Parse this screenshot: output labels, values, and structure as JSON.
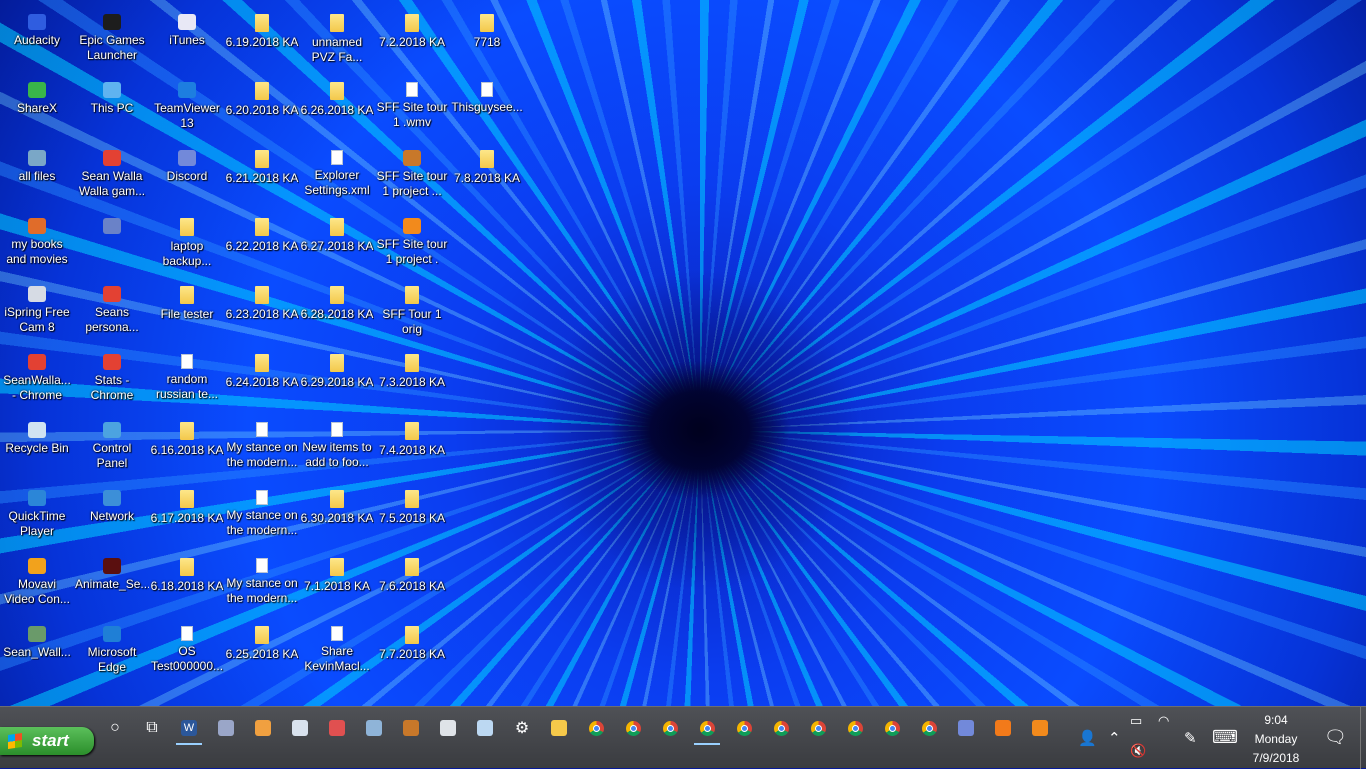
{
  "desktop": {
    "icons": [
      {
        "label1": "Audacity",
        "label2": "",
        "icon": "audacity-icon",
        "kind": "app",
        "color": "#2f5de0"
      },
      {
        "label1": "ShareX",
        "label2": "",
        "icon": "sharex-icon",
        "kind": "app",
        "color": "#39b54a"
      },
      {
        "label1": "all files",
        "label2": "",
        "icon": "monitor-icon",
        "kind": "app",
        "color": "#7aa7c7"
      },
      {
        "label1": "my books",
        "label2": "and movies",
        "icon": "books-icon",
        "kind": "app",
        "color": "#e06c2a"
      },
      {
        "label1": "iSpring Free",
        "label2": "Cam 8",
        "icon": "ispring-icon",
        "kind": "app",
        "color": "#d6dbe4"
      },
      {
        "label1": "SeanWalla...",
        "label2": "- Chrome",
        "icon": "chrome-app-icon",
        "kind": "app",
        "color": "#e34133"
      },
      {
        "label1": "Recycle Bin",
        "label2": "",
        "icon": "recycle-bin-icon",
        "kind": "app",
        "color": "#cfe3f2"
      },
      {
        "label1": "QuickTime",
        "label2": "Player",
        "icon": "quicktime-icon",
        "kind": "app",
        "color": "#2b86d8"
      },
      {
        "label1": "Movavi",
        "label2": "Video Con...",
        "icon": "movavi-icon",
        "kind": "app",
        "color": "#f2a21c"
      },
      {
        "label1": "Sean_Wall...",
        "label2": "",
        "icon": "user-figure-icon",
        "kind": "app",
        "color": "#6a9a6a"
      },
      {
        "label1": "Epic Games",
        "label2": "Launcher",
        "icon": "epic-games-icon",
        "kind": "app",
        "color": "#1d1d1d"
      },
      {
        "label1": "This PC",
        "label2": "",
        "icon": "this-pc-icon",
        "kind": "app",
        "color": "#5fb3f0"
      },
      {
        "label1": "Sean Walla",
        "label2": "Walla gam...",
        "icon": "chrome-app-icon",
        "kind": "app",
        "color": "#e34133"
      },
      {
        "label1": "",
        "label2": "",
        "icon": "blank-shortcut-icon",
        "kind": "app",
        "color": "#6a82c8"
      },
      {
        "label1": "Seans",
        "label2": "persona...",
        "icon": "chrome-app-icon",
        "kind": "app",
        "color": "#e34133"
      },
      {
        "label1": "Stats -",
        "label2": "Chrome",
        "icon": "chrome-app-icon",
        "kind": "app",
        "color": "#e34133"
      },
      {
        "label1": "Control",
        "label2": "Panel",
        "icon": "control-panel-icon",
        "kind": "app",
        "color": "#4ca3e0"
      },
      {
        "label1": "Network",
        "label2": "",
        "icon": "network-icon",
        "kind": "app",
        "color": "#3c8fd8"
      },
      {
        "label1": "Animate_Se...",
        "label2": "",
        "icon": "animate-icon",
        "kind": "app",
        "color": "#5a0f0f"
      },
      {
        "label1": "Microsoft",
        "label2": "Edge",
        "icon": "edge-icon",
        "kind": "app",
        "color": "#1f7fd6"
      },
      {
        "label1": "iTunes",
        "label2": "",
        "icon": "itunes-icon",
        "kind": "app",
        "color": "#e8e8f6"
      },
      {
        "label1": "TeamViewer",
        "label2": "13",
        "icon": "teamviewer-icon",
        "kind": "app",
        "color": "#1d7ee0"
      },
      {
        "label1": "Discord",
        "label2": "",
        "icon": "discord-icon",
        "kind": "app",
        "color": "#7289da"
      },
      {
        "label1": "laptop",
        "label2": "backup...",
        "icon": "folder-icon",
        "kind": "folder",
        "color": ""
      },
      {
        "label1": "File tester",
        "label2": "",
        "icon": "folder-icon",
        "kind": "folder",
        "color": ""
      },
      {
        "label1": "random",
        "label2": "russian te...",
        "icon": "text-file-icon",
        "kind": "doc",
        "color": ""
      },
      {
        "label1": "6.16.2018 KA",
        "label2": "",
        "icon": "folder-icon",
        "kind": "folder",
        "color": ""
      },
      {
        "label1": "6.17.2018 KA",
        "label2": "",
        "icon": "folder-icon",
        "kind": "folder",
        "color": ""
      },
      {
        "label1": "6.18.2018 KA",
        "label2": "",
        "icon": "folder-icon",
        "kind": "folder",
        "color": ""
      },
      {
        "label1": "OS",
        "label2": "Test000000...",
        "icon": "word-doc-icon",
        "kind": "doc",
        "color": ""
      },
      {
        "label1": "6.19.2018 KA",
        "label2": "",
        "icon": "folder-icon",
        "kind": "folder",
        "color": ""
      },
      {
        "label1": "6.20.2018 KA",
        "label2": "",
        "icon": "folder-icon",
        "kind": "folder",
        "color": ""
      },
      {
        "label1": "6.21.2018 KA",
        "label2": "",
        "icon": "folder-icon",
        "kind": "folder",
        "color": ""
      },
      {
        "label1": "6.22.2018 KA",
        "label2": "",
        "icon": "folder-icon",
        "kind": "folder",
        "color": ""
      },
      {
        "label1": "6.23.2018 KA",
        "label2": "",
        "icon": "folder-icon",
        "kind": "folder",
        "color": ""
      },
      {
        "label1": "6.24.2018 KA",
        "label2": "",
        "icon": "folder-icon",
        "kind": "folder",
        "color": ""
      },
      {
        "label1": "My stance on",
        "label2": "the modern...",
        "icon": "text-file-icon",
        "kind": "doc",
        "color": ""
      },
      {
        "label1": "My stance on",
        "label2": "the modern...",
        "icon": "word-doc-icon",
        "kind": "doc",
        "color": ""
      },
      {
        "label1": "My stance on",
        "label2": "the modern...",
        "icon": "image-file-icon",
        "kind": "doc",
        "color": ""
      },
      {
        "label1": "6.25.2018 KA",
        "label2": "",
        "icon": "folder-icon",
        "kind": "folder",
        "color": ""
      },
      {
        "label1": "unnamed",
        "label2": "PVZ Fa...",
        "icon": "folder-icon",
        "kind": "folder",
        "color": ""
      },
      {
        "label1": "6.26.2018 KA",
        "label2": "",
        "icon": "folder-icon",
        "kind": "folder",
        "color": ""
      },
      {
        "label1": "Explorer",
        "label2": "Settings.xml",
        "icon": "xml-file-icon",
        "kind": "doc",
        "color": ""
      },
      {
        "label1": "6.27.2018 KA",
        "label2": "",
        "icon": "folder-icon",
        "kind": "folder",
        "color": ""
      },
      {
        "label1": "6.28.2018 KA",
        "label2": "",
        "icon": "folder-icon",
        "kind": "folder",
        "color": ""
      },
      {
        "label1": "6.29.2018 KA",
        "label2": "",
        "icon": "folder-icon",
        "kind": "folder",
        "color": ""
      },
      {
        "label1": "New items to",
        "label2": "add to foo...",
        "icon": "text-file-icon",
        "kind": "doc",
        "color": ""
      },
      {
        "label1": "6.30.2018 KA",
        "label2": "",
        "icon": "folder-icon",
        "kind": "folder",
        "color": ""
      },
      {
        "label1": "7.1.2018 KA",
        "label2": "",
        "icon": "folder-icon",
        "kind": "folder",
        "color": ""
      },
      {
        "label1": "Share",
        "label2": "KevinMacl...",
        "icon": "text-file-icon",
        "kind": "doc",
        "color": ""
      },
      {
        "label1": "7.2.2018 KA",
        "label2": "",
        "icon": "folder-icon",
        "kind": "folder",
        "color": ""
      },
      {
        "label1": "SFF Site tour",
        "label2": "1 .wmv",
        "icon": "video-file-icon",
        "kind": "doc",
        "color": ""
      },
      {
        "label1": "SFF Site tour",
        "label2": "1 project ...",
        "icon": "film-strip-icon",
        "kind": "app",
        "color": "#c8782a"
      },
      {
        "label1": "SFF Site tour",
        "label2": "1 project .",
        "icon": "vlc-icon",
        "kind": "app",
        "color": "#f28a1c"
      },
      {
        "label1": "SFF Tour 1",
        "label2": "orig",
        "icon": "folder-icon",
        "kind": "folder",
        "color": ""
      },
      {
        "label1": "7.3.2018 KA",
        "label2": "",
        "icon": "folder-icon",
        "kind": "folder",
        "color": ""
      },
      {
        "label1": "7.4.2018 KA",
        "label2": "",
        "icon": "folder-icon",
        "kind": "folder",
        "color": ""
      },
      {
        "label1": "7.5.2018 KA",
        "label2": "",
        "icon": "folder-icon",
        "kind": "folder",
        "color": ""
      },
      {
        "label1": "7.6.2018 KA",
        "label2": "",
        "icon": "folder-icon",
        "kind": "folder",
        "color": ""
      },
      {
        "label1": "7.7.2018 KA",
        "label2": "",
        "icon": "folder-icon",
        "kind": "folder",
        "color": ""
      },
      {
        "label1": "7718",
        "label2": "",
        "icon": "folder-icon",
        "kind": "folder",
        "color": ""
      },
      {
        "label1": "Thisguysee...",
        "label2": "",
        "icon": "text-file-icon",
        "kind": "doc",
        "color": ""
      },
      {
        "label1": "7.8.2018 KA",
        "label2": "",
        "icon": "folder-icon",
        "kind": "folder",
        "color": ""
      }
    ]
  },
  "taskbar": {
    "start_label": "start",
    "pinned": [
      {
        "icon": "cortana-circle-icon",
        "glyph": "○",
        "color": ""
      },
      {
        "icon": "task-view-icon",
        "glyph": "⧉",
        "color": ""
      },
      {
        "icon": "word-icon",
        "glyph": "W",
        "color": "#2b579a",
        "active": true
      },
      {
        "icon": "audio-tool-icon",
        "glyph": "",
        "color": "#9aa6c8"
      },
      {
        "icon": "paint-icon",
        "glyph": "",
        "color": "#f0a040"
      },
      {
        "icon": "notepad-icon",
        "glyph": "",
        "color": "#d9e2ee"
      },
      {
        "icon": "snipping-tool-icon",
        "glyph": "",
        "color": "#e05050"
      },
      {
        "icon": "photos-icon",
        "glyph": "",
        "color": "#8fb4d8"
      },
      {
        "icon": "film-strip-icon",
        "glyph": "",
        "color": "#c8782a"
      },
      {
        "icon": "calculator-icon",
        "glyph": "",
        "color": "#dfe3e8"
      },
      {
        "icon": "sticky-notes-icon",
        "glyph": "",
        "color": "#bcd8f2"
      },
      {
        "icon": "settings-gear-icon",
        "glyph": "⚙",
        "color": ""
      },
      {
        "icon": "file-explorer-icon",
        "glyph": "",
        "color": "#f6c94a"
      },
      {
        "icon": "chrome-icon",
        "glyph": "",
        "color": "chrome"
      },
      {
        "icon": "chrome-icon",
        "glyph": "",
        "color": "chrome"
      },
      {
        "icon": "chrome-icon",
        "glyph": "",
        "color": "chrome"
      },
      {
        "icon": "chrome-icon",
        "glyph": "",
        "color": "chrome",
        "active": true
      },
      {
        "icon": "chrome-icon",
        "glyph": "",
        "color": "chrome"
      },
      {
        "icon": "chrome-icon",
        "glyph": "",
        "color": "chrome"
      },
      {
        "icon": "chrome-icon",
        "glyph": "",
        "color": "chrome"
      },
      {
        "icon": "chrome-icon",
        "glyph": "",
        "color": "chrome"
      },
      {
        "icon": "chrome-icon",
        "glyph": "",
        "color": "chrome"
      },
      {
        "icon": "chrome-icon",
        "glyph": "",
        "color": "chrome"
      },
      {
        "icon": "discord-icon",
        "glyph": "",
        "color": "#7289da"
      },
      {
        "icon": "firefox-icon",
        "glyph": "",
        "color": "#f27a1a"
      },
      {
        "icon": "vlc-icon",
        "glyph": "",
        "color": "#f28a1c"
      }
    ],
    "tray": {
      "people_icon": "people-icon",
      "chevron_icon": "chevron-up-icon",
      "battery_icon": "battery-icon",
      "wifi_icon": "wifi-icon",
      "volume_icon": "volume-muted-icon",
      "pen_icon": "pen-icon",
      "keyboard_icon": "keyboard-icon",
      "notification_icon": "action-center-icon"
    },
    "clock": {
      "time": "9:04",
      "day": "Monday",
      "date": "7/9/2018"
    }
  }
}
